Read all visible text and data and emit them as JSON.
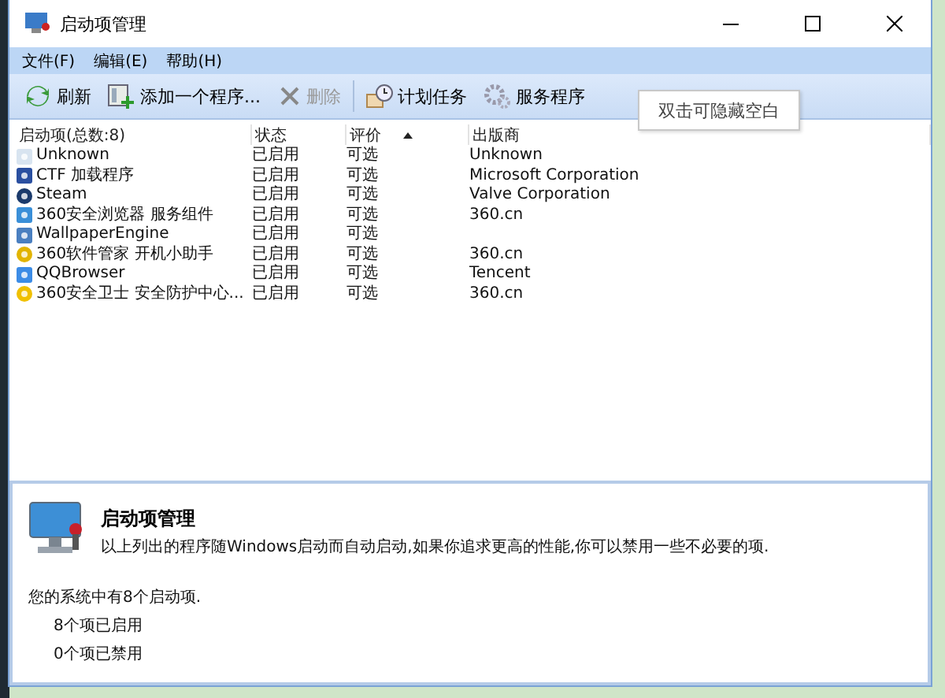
{
  "window": {
    "title": "启动项管理"
  },
  "menu": [
    "文件(F)",
    "编辑(E)",
    "帮助(H)"
  ],
  "toolbar": [
    {
      "label": "刷新",
      "disabled": false
    },
    {
      "label": "添加一个程序...",
      "disabled": false
    },
    {
      "label": "删除",
      "disabled": true
    },
    {
      "label": "计划任务",
      "disabled": false
    },
    {
      "label": "服务程序",
      "disabled": false
    }
  ],
  "tooltip": "双击可隐藏空白",
  "table": {
    "columns": [
      {
        "label": "启动项(总数:8)",
        "sorted": false
      },
      {
        "label": "状态",
        "sorted": false
      },
      {
        "label": "评价",
        "sorted": true
      },
      {
        "label": "出版商",
        "sorted": false
      }
    ],
    "rows": [
      [
        "Unknown",
        "已启用",
        "可选",
        "Unknown"
      ],
      [
        "CTF 加载程序",
        "已启用",
        "可选",
        "Microsoft Corporation"
      ],
      [
        "Steam",
        "已启用",
        "可选",
        "Valve Corporation"
      ],
      [
        "360安全浏览器 服务组件",
        "已启用",
        "可选",
        "360.cn"
      ],
      [
        "WallpaperEngine",
        "已启用",
        "可选",
        ""
      ],
      [
        "360软件管家 开机小助手",
        "已启用",
        "可选",
        "360.cn"
      ],
      [
        "QQBrowser",
        "已启用",
        "可选",
        "Tencent"
      ],
      [
        "360安全卫士 安全防护中心...",
        "已启用",
        "可选",
        "360.cn"
      ]
    ]
  },
  "info": {
    "title": "启动项管理",
    "description": "以上列出的程序随Windows启动而自动启动,如果你追求更高的性能,你可以禁用一些不必要的项.",
    "summary": "您的系统中有8个启动项.",
    "details": [
      "8个项已启用",
      "0个项已禁用"
    ]
  }
}
